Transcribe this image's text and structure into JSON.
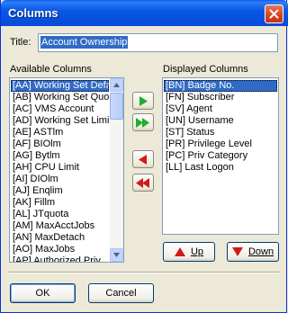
{
  "window": {
    "title": "Columns"
  },
  "title_field": {
    "label": "Title:",
    "value": "Account Ownership"
  },
  "available": {
    "label": "Available Columns",
    "items": [
      "[AA] Working Set Defa",
      "[AB] Working Set Quo",
      "[AC] VMS Account",
      "[AD] Working Set Limi",
      "[AE] ASTlm",
      "[AF] BIOlm",
      "[AG] Bytlm",
      "[AH] CPU Limit",
      "[AI] DIOlm",
      "[AJ] Enqlim",
      "[AK] Fillm",
      "[AL] JTquota",
      "[AM] MaxAcctJobs",
      "[AN] MaxDetach",
      "[AO] MaxJobs",
      "[AP] Authorized Priv"
    ],
    "selected_index": 0
  },
  "displayed": {
    "label": "Displayed Columns",
    "items": [
      "[BN] Badge No.",
      "[FN] Subscriber",
      "[SV] Agent",
      "[UN] Username",
      "[ST] Status",
      "[PR] Privilege Level",
      "[PC] Priv Category",
      "[LL] Last Logon"
    ],
    "selected_index": 0
  },
  "buttons": {
    "up": "Up",
    "down": "Down",
    "ok": "OK",
    "cancel": "Cancel"
  },
  "colors": {
    "add_arrow": "#1fae2e",
    "remove_arrow": "#d11a1a"
  }
}
